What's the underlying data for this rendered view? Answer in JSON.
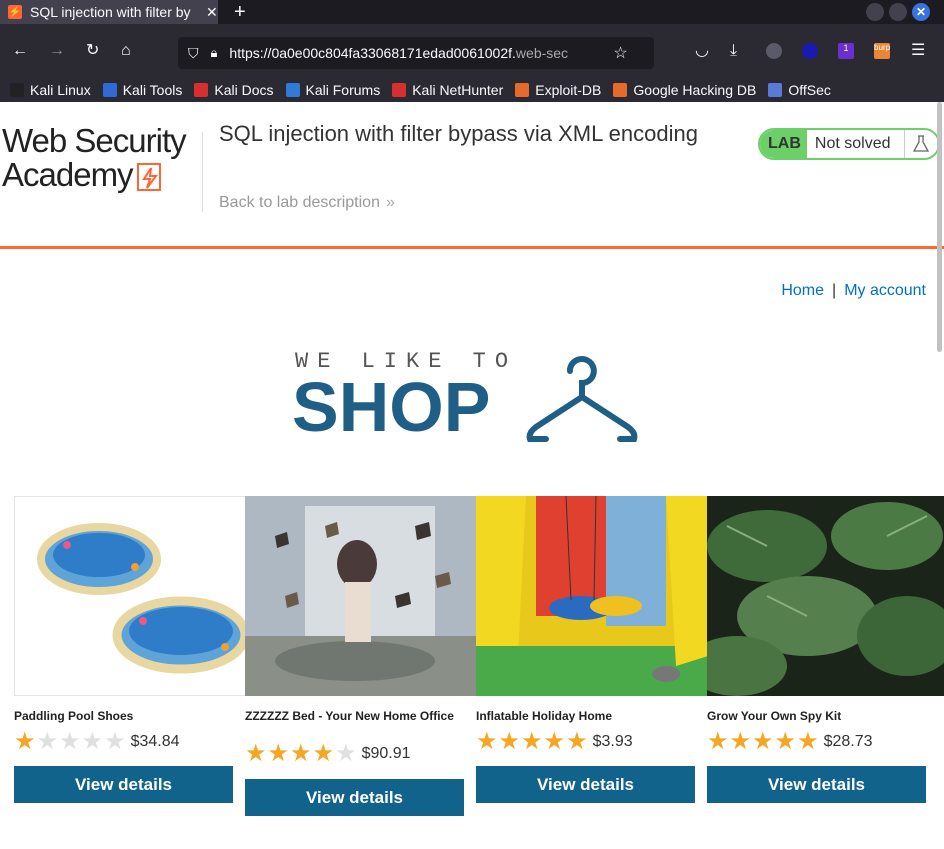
{
  "browser": {
    "tab_title": "SQL injection with filter by",
    "new_tab": "+",
    "url_main": "https://0a0e00c804fa33068171edad0061002f.",
    "url_dim": "web-sec",
    "bookmarks": [
      {
        "label": "Kali Linux",
        "color": "#222222"
      },
      {
        "label": "Kali Tools",
        "color": "#2f6bd6"
      },
      {
        "label": "Kali Docs",
        "color": "#d62f2f"
      },
      {
        "label": "Kali Forums",
        "color": "#2f7bd6"
      },
      {
        "label": "Kali NetHunter",
        "color": "#d62f2f"
      },
      {
        "label": "Exploit-DB",
        "color": "#e46a2e"
      },
      {
        "label": "Google Hacking DB",
        "color": "#e46a2e"
      },
      {
        "label": "OffSec",
        "color": "#5a7ad6"
      }
    ],
    "ext_badge": "1",
    "ext_burp": "burp"
  },
  "header": {
    "logo_line1": "Web Security",
    "logo_line2": "Academy",
    "lab_title": "SQL injection with filter bypass via XML encoding",
    "back_link": "Back to lab description",
    "status_lab": "LAB",
    "status_text": "Not solved"
  },
  "nav": {
    "home": "Home",
    "separator": "|",
    "account": "My account"
  },
  "shop_logo": {
    "small": "WE LIKE TO",
    "big": "SHOP"
  },
  "products": [
    {
      "name": "Paddling Pool Shoes",
      "rating": 1,
      "price": "$34.84",
      "button": "View details"
    },
    {
      "name": "ZZZZZZ Bed - Your New Home Office",
      "rating": 4,
      "price": "$90.91",
      "button": "View details"
    },
    {
      "name": "Inflatable Holiday Home",
      "rating": 5,
      "price": "$3.93",
      "button": "View details"
    },
    {
      "name": "Grow Your Own Spy Kit",
      "rating": 5,
      "price": "$28.73",
      "button": "View details"
    }
  ],
  "colors": {
    "accent": "#ff6633",
    "button": "#12638b",
    "link": "#0071bc",
    "status_green": "#6bd068",
    "star": "#f5a623"
  }
}
